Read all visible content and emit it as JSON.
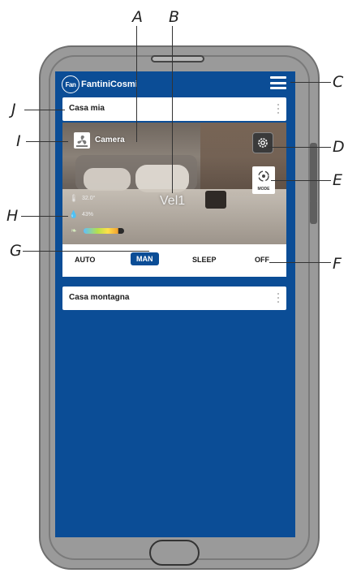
{
  "app": {
    "logo_text": "FantiniCosmi",
    "logo_badge": "Fan"
  },
  "cards": [
    {
      "title": "Casa mia",
      "room": {
        "name": "Camera",
        "speed": "Vel1",
        "temperature": "32.0°",
        "humidity": "43%",
        "air_quality_level": 0.85
      },
      "modes": [
        "AUTO",
        "MAN",
        "SLEEP",
        "OFF"
      ],
      "active_mode": "MAN",
      "mode_button_label": "MODE"
    },
    {
      "title": "Casa montagna"
    }
  ],
  "callouts": [
    "A",
    "B",
    "C",
    "D",
    "E",
    "F",
    "G",
    "H",
    "I",
    "J"
  ],
  "colors": {
    "screen_bg": "#0b4d96",
    "active_mode_bg": "#0b4d96",
    "phone_body": "#9a9a9a"
  },
  "icons": [
    "menu-icon",
    "kebab-icon",
    "fan-icon",
    "gear-icon",
    "mode-icon",
    "thermometer-icon",
    "droplet-icon",
    "leaf-icon"
  ]
}
